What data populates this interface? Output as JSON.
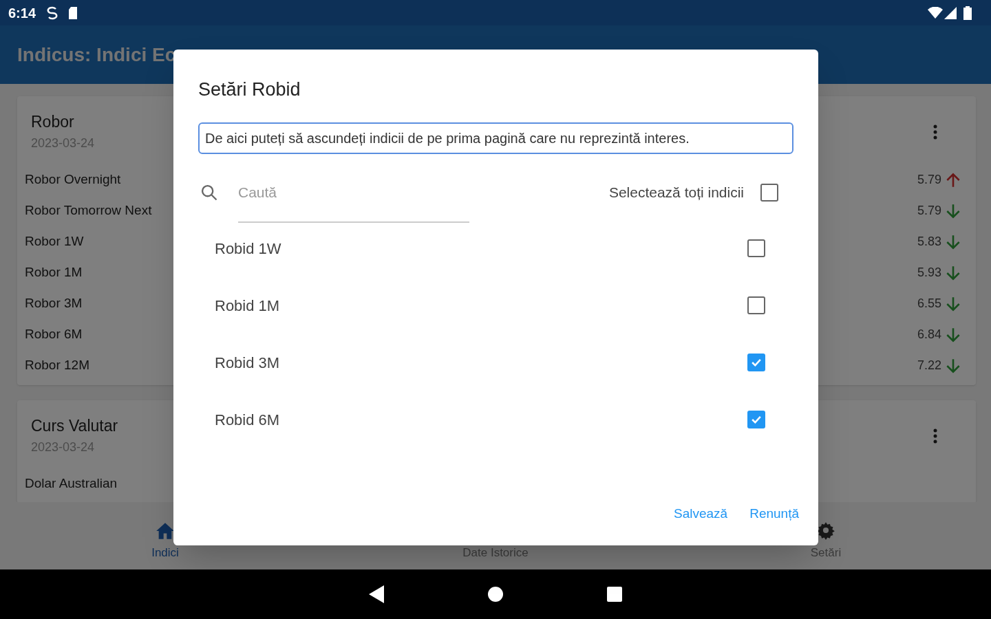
{
  "status_bar": {
    "time": "6:14"
  },
  "app_bar": {
    "title": "Indicus: Indici Ec"
  },
  "cards": [
    {
      "title": "Robor",
      "date": "2023-03-24",
      "rows": [
        {
          "name": "Robor Overnight",
          "value": "5.79",
          "rising": true
        },
        {
          "name": "Robor Tomorrow Next",
          "value": "5.79",
          "rising": false
        },
        {
          "name": "Robor 1W",
          "value": "5.83",
          "rising": false
        },
        {
          "name": "Robor 1M",
          "value": "5.93",
          "rising": false
        },
        {
          "name": "Robor 3M",
          "value": "6.55",
          "rising": false
        },
        {
          "name": "Robor 6M",
          "value": "6.84",
          "rising": false
        },
        {
          "name": "Robor 12M",
          "value": "7.22",
          "rising": false
        }
      ]
    },
    {
      "title": "Curs Valutar",
      "date": "2023-03-24",
      "rows": [
        {
          "name": "Dolar Australian"
        }
      ]
    }
  ],
  "bottom_nav": [
    {
      "label": "Indici",
      "selected": true
    },
    {
      "label": "Date Istorice",
      "selected": false
    },
    {
      "label": "Setări",
      "selected": false
    }
  ],
  "dialog": {
    "title": "Setări Robid",
    "note": "De aici puteți să ascundeți indicii de pe prima pagină care nu reprezintă interes.",
    "search": {
      "placeholder": "Caută"
    },
    "select_all": {
      "label": "Selectează toți indicii",
      "checked": false
    },
    "items": [
      {
        "label": "Robid 1W",
        "checked": false
      },
      {
        "label": "Robid 1M",
        "checked": false
      },
      {
        "label": "Robid 3M",
        "checked": true
      },
      {
        "label": "Robid 6M",
        "checked": true
      }
    ],
    "buttons": [
      "Salvează",
      "Renunță"
    ]
  }
}
